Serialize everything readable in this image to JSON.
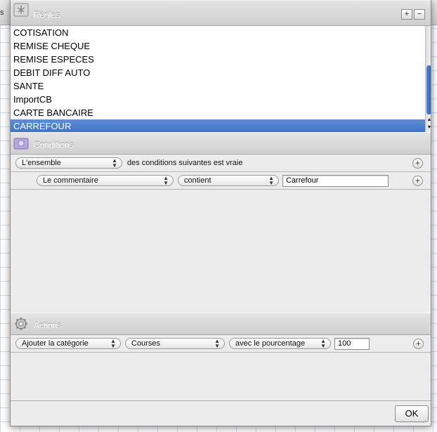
{
  "background": {
    "header_fragment": "s"
  },
  "rules": {
    "title": "Règles",
    "add_label": "+",
    "remove_label": "−",
    "items": [
      {
        "label": "COTISATION"
      },
      {
        "label": "REMISE CHEQUE"
      },
      {
        "label": "REMISE ESPECES"
      },
      {
        "label": "DEBIT DIFF AUTO"
      },
      {
        "label": "SANTE"
      },
      {
        "label": "ImportCB"
      },
      {
        "label": "CARTE BANCAIRE"
      },
      {
        "label": "CARREFOUR"
      }
    ],
    "selected_index": 7
  },
  "conditions": {
    "title": "Conditions",
    "match_select": "L'ensemble",
    "match_text": "des conditions suivantes est vraie",
    "criteria": [
      {
        "field": "Le commentaire",
        "operator": "contient",
        "value": "Carrefour"
      }
    ],
    "add_label": "+"
  },
  "actions": {
    "title": "Actions",
    "items": [
      {
        "action": "Ajouter la catégorie",
        "category": "Courses",
        "mode": "avec le pourcentage",
        "value": "100"
      }
    ],
    "add_label": "+"
  },
  "footer": {
    "ok_label": "OK"
  },
  "colors": {
    "selection": "#3f75c8",
    "panel": "#ececec",
    "scroll_thumb": "#3b72c8"
  }
}
